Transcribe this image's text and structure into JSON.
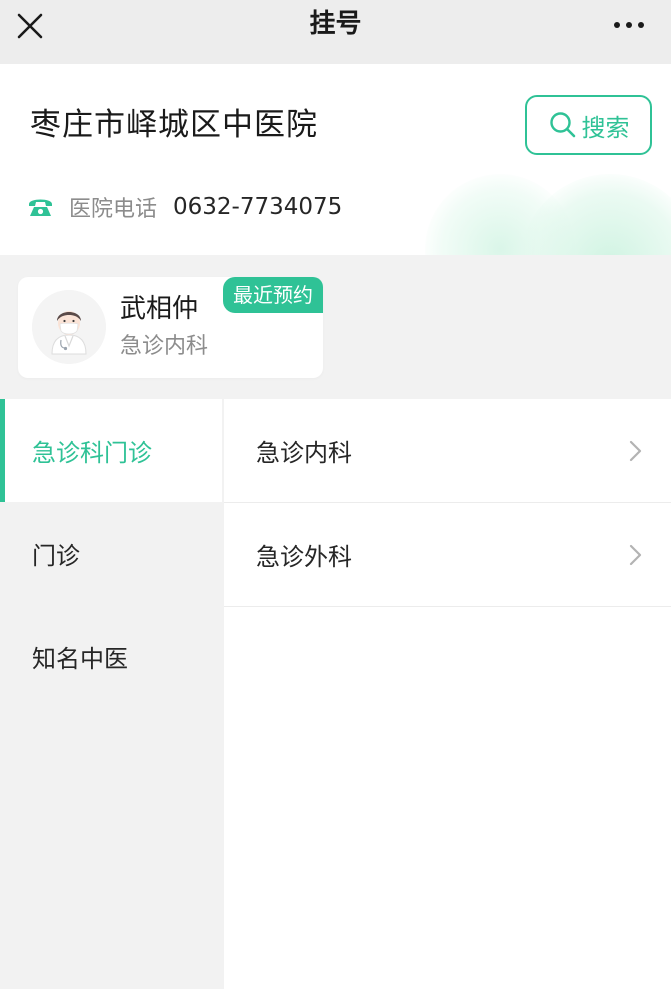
{
  "topbar": {
    "title": "挂号",
    "close_icon": "close-icon",
    "more_icon": "more-dots-icon"
  },
  "hospital": {
    "name": "枣庄市峄城区中医院",
    "search_label": "搜索",
    "phone_label": "医院电话",
    "phone_number": "0632-7734075"
  },
  "recent": {
    "badge": "最近预约",
    "doctor_name": "武相仲",
    "department": "急诊内科"
  },
  "nav": {
    "items": [
      {
        "label": "急诊科门诊",
        "active": true
      },
      {
        "label": "门诊",
        "active": false
      },
      {
        "label": "知名中医",
        "active": false
      }
    ]
  },
  "departments": {
    "items": [
      {
        "label": "急诊内科"
      },
      {
        "label": "急诊外科"
      }
    ]
  },
  "colors": {
    "accent": "#2fc296",
    "topbar_bg": "#ededed",
    "page_bg": "#f2f2f2"
  }
}
